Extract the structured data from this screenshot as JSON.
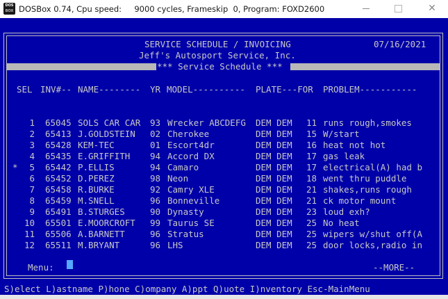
{
  "window": {
    "icon_line1": "DOS",
    "icon_line2": "BOX",
    "title": "DOSBox 0.74, Cpu speed:     9000 cycles, Frameskip  0, Program: FOXD2600",
    "close_glyph": "✕"
  },
  "header": {
    "title": "SERVICE SCHEDULE / INVOICING",
    "date": "07/16/2021",
    "company": "Jeff's Autosport Service, Inc.",
    "subtitle": "*** Service Schedule ***"
  },
  "table": {
    "columns": {
      "sel": "SEL",
      "inv": "INV#--",
      "name": "NAME--------",
      "yr": "YR",
      "model": "MODEL----------",
      "plate": "PLATE---FOR",
      "problem": "PROBLEM-----------"
    },
    "rows": [
      {
        "mark": "",
        "sel": "1",
        "inv": "65045",
        "name": "SOLS CAR CAR",
        "yr": "93",
        "model": "Wrecker ABCDEFG",
        "plate": "DEM DEM",
        "for": "11",
        "problem": "runs rough,smokes"
      },
      {
        "mark": "",
        "sel": "2",
        "inv": "65413",
        "name": "J.GOLDSTEIN",
        "yr": "02",
        "model": "Cherokee",
        "plate": "DEM DEM",
        "for": "15",
        "problem": "W/start"
      },
      {
        "mark": "",
        "sel": "3",
        "inv": "65428",
        "name": "KEM-TEC",
        "yr": "01",
        "model": "Escort4dr",
        "plate": "DEM DEM",
        "for": "16",
        "problem": "heat not hot"
      },
      {
        "mark": "",
        "sel": "4",
        "inv": "65435",
        "name": "E.GRIFFITH",
        "yr": "94",
        "model": "Accord DX",
        "plate": "DEM DEM",
        "for": "17",
        "problem": "gas leak"
      },
      {
        "mark": "*",
        "sel": "5",
        "inv": "65442",
        "name": "P.ELLIS",
        "yr": "94",
        "model": "Camaro",
        "plate": "DEM DEM",
        "for": "17",
        "problem": "electrical(A) had b"
      },
      {
        "mark": "",
        "sel": "6",
        "inv": "65452",
        "name": "D.PEREZ",
        "yr": "98",
        "model": "Neon",
        "plate": "DEM DEM",
        "for": "18",
        "problem": "went thru puddle"
      },
      {
        "mark": "",
        "sel": "7",
        "inv": "65458",
        "name": "R.BURKE",
        "yr": "92",
        "model": "Camry XLE",
        "plate": "DEM DEM",
        "for": "21",
        "problem": "shakes,runs rough"
      },
      {
        "mark": "",
        "sel": "8",
        "inv": "65459",
        "name": "M.SNELL",
        "yr": "96",
        "model": "Bonneville",
        "plate": "DEM DEM",
        "for": "21",
        "problem": "ck motor mount"
      },
      {
        "mark": "",
        "sel": "9",
        "inv": "65491",
        "name": "B.STURGES",
        "yr": "90",
        "model": "Dynasty",
        "plate": "DEM DEM",
        "for": "23",
        "problem": "loud exh?"
      },
      {
        "mark": "",
        "sel": "10",
        "inv": "65501",
        "name": "E.MOORCROFT",
        "yr": "99",
        "model": "Taurus SE",
        "plate": "DEM DEM",
        "for": "25",
        "problem": "No heat"
      },
      {
        "mark": "",
        "sel": "11",
        "inv": "65506",
        "name": "A.BARNETT",
        "yr": "96",
        "model": "Stratus",
        "plate": "DEM DEM",
        "for": "25",
        "problem": "wipers w/shut off(A"
      },
      {
        "mark": "",
        "sel": "12",
        "inv": "65511",
        "name": "M.BRYANT",
        "yr": "96",
        "model": "LHS",
        "plate": "DEM DEM",
        "for": "25",
        "problem": "door locks,radio in"
      }
    ]
  },
  "footer": {
    "menu_label": "Menu:",
    "more": "--MORE--",
    "status": "S)elect L)astname P)hone C)ompany A)ppt Q)uote I)nventory Esc-MainMenu"
  },
  "colors": {
    "dos_bg": "#0000a8",
    "dos_text": "#c8c8c8",
    "cursor": "#55a8ff"
  }
}
